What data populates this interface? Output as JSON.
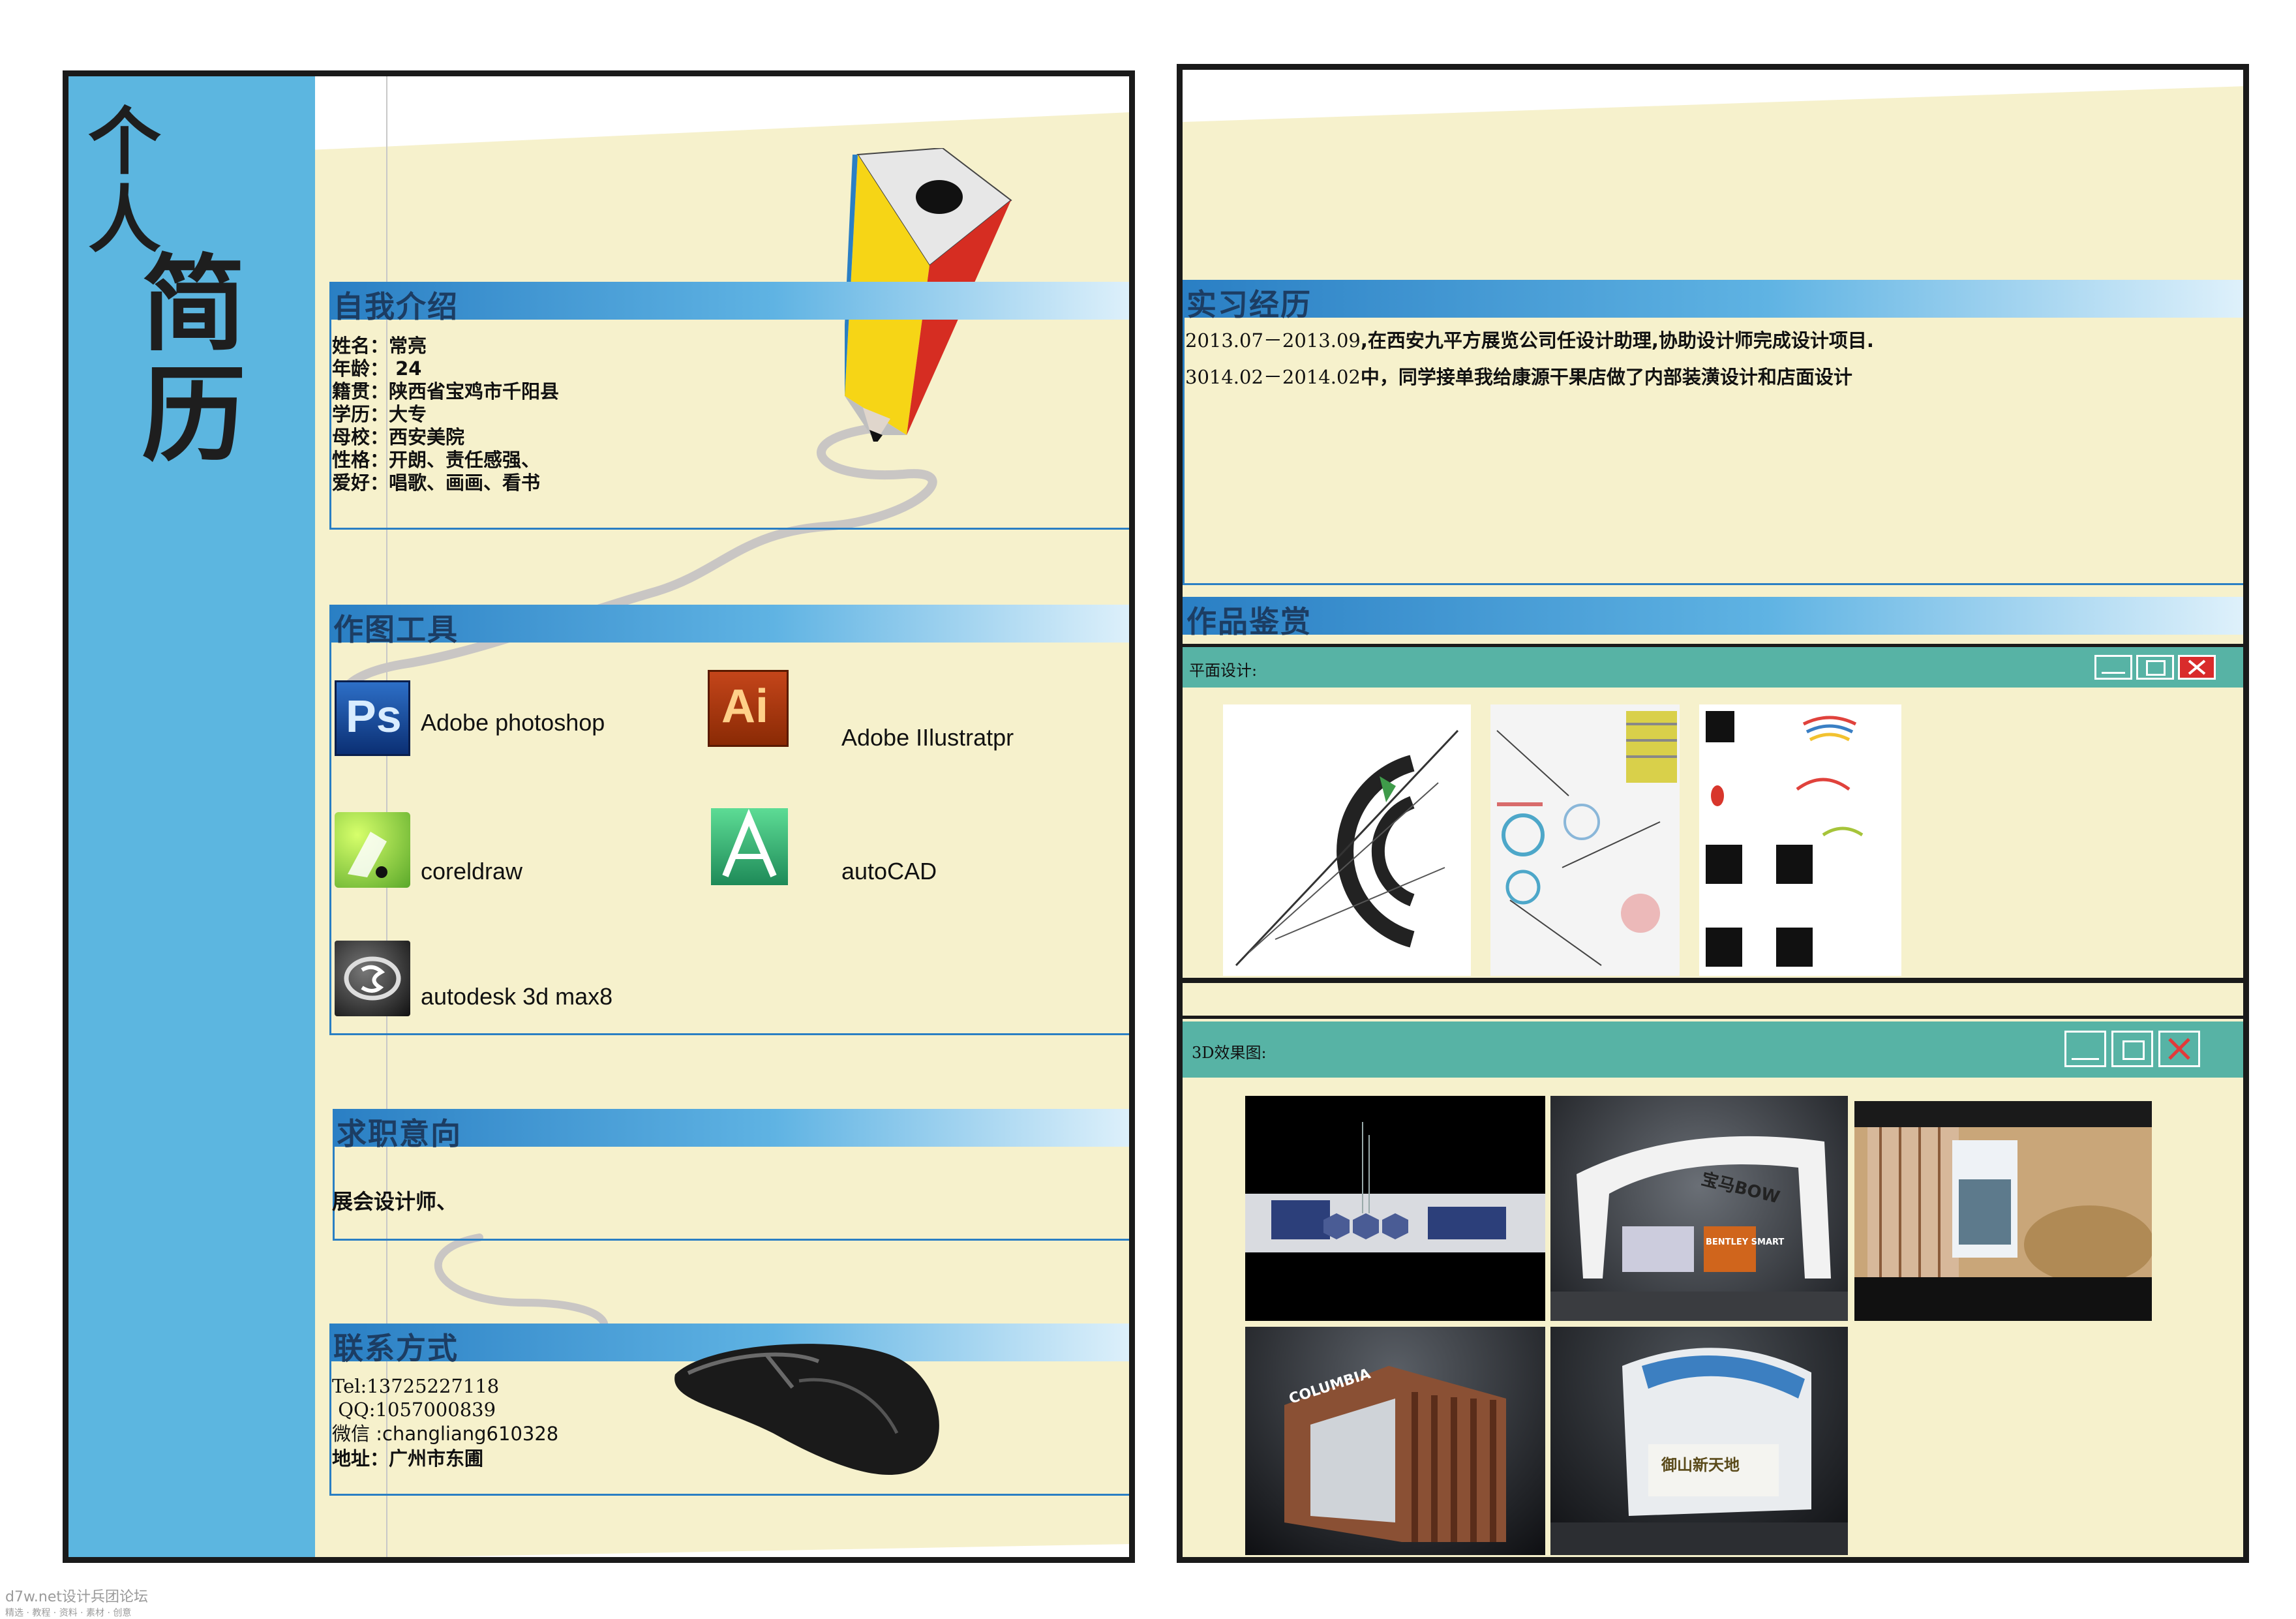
{
  "left": {
    "title_chars": [
      "个",
      "人",
      "简",
      "历"
    ],
    "self_intro": {
      "heading": "自我介绍",
      "lines": [
        "姓名：常亮",
        "年龄：  24",
        "籍贯：陕西省宝鸡市千阳县",
        "学历：大专",
        "母校：西安美院",
        "性格：开朗、责任感强、",
        "爱好：唱歌、画画、看书"
      ]
    },
    "tools": {
      "heading": "作图工具",
      "items": [
        {
          "icon": "photoshop-icon",
          "icon_text": "Ps",
          "label": "Adobe  photoshop"
        },
        {
          "icon": "illustrator-icon",
          "icon_text": "Ai",
          "label": "Adobe IIlustratpr"
        },
        {
          "icon": "coreldraw-icon",
          "icon_text": "",
          "label": "coreldraw"
        },
        {
          "icon": "autocad-icon",
          "icon_text": "",
          "label": "autoCAD"
        },
        {
          "icon": "3dsmax-icon",
          "icon_text": "",
          "label": "autodesk 3d max8"
        }
      ]
    },
    "job": {
      "heading": "求职意向",
      "text": "展会设计师、"
    },
    "contact": {
      "heading": "联系方式",
      "lines": [
        "Tel:13725227118",
        " QQ:1057000839",
        "微信 :changliang610328",
        "地址：广州市东圃"
      ]
    }
  },
  "right": {
    "internship": {
      "heading": "实习经历",
      "lines": [
        {
          "date": "2013.07－2013.09",
          "text": ",在西安九平方展览公司任设计助理,协助设计师完成设计项目."
        },
        {
          "date": "3014.02－2014.02",
          "text": "中，同学接单我给康源干果店做了内部装潢设计和店面设计"
        }
      ]
    },
    "works": {
      "heading": "作品鉴赏",
      "flat_window_title": "平面设计:",
      "render_window_title": "3D效果图:",
      "render_captions": [
        "宝马BOW",
        "BENTLEY SMART",
        "COLUMBIA",
        "御山新天地"
      ]
    }
  },
  "watermark": {
    "line1": "d7w.net设计兵团论坛",
    "line2": "精选 · 教程 · 资料 · 素材 · 创意"
  },
  "colors": {
    "sidebar_blue": "#5cb6e0",
    "cream": "#f6f1cc",
    "header_blue": "#2a7fc4",
    "window_teal": "#57b3a5",
    "close_red": "#d92b2b"
  }
}
